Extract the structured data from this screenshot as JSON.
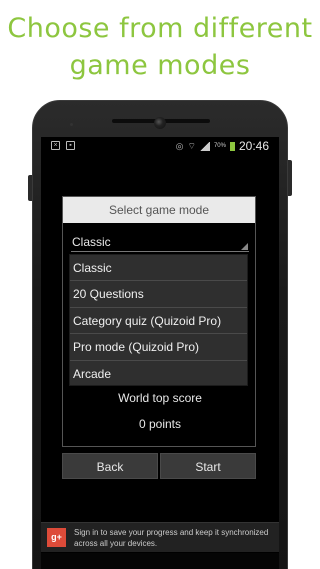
{
  "headline": {
    "line1": "Choose from different",
    "line2": "game modes"
  },
  "status_bar": {
    "battery": "70%",
    "time": "20:46"
  },
  "dialog": {
    "title": "Select game mode",
    "selected_value": "Classic",
    "options": [
      "Classic",
      "20 Questions",
      "Category quiz (Quizoid Pro)",
      "Pro mode (Quizoid Pro)",
      "Arcade"
    ],
    "world_top_score_label": "World top score",
    "points_text": "0 points"
  },
  "buttons": {
    "back": "Back",
    "start": "Start"
  },
  "signin_banner": {
    "icon": "g+",
    "text": "Sign in to save your progress and keep it synchronized across all your devices."
  },
  "colors": {
    "headline": "#8dc63f",
    "google_plus": "#dd4b39",
    "battery": "#8dc63f"
  }
}
